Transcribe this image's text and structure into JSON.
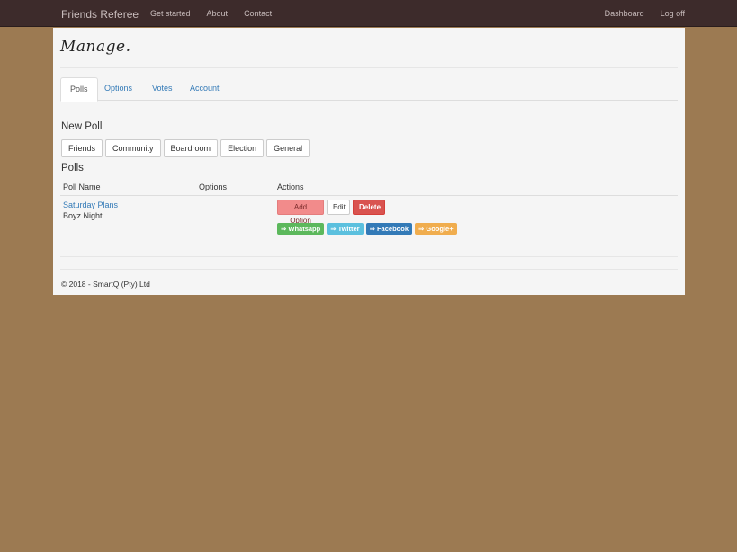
{
  "navbar": {
    "brand": "Friends Referee",
    "left_links": [
      "Get started",
      "About",
      "Contact"
    ],
    "right_links": [
      "Dashboard",
      "Log off"
    ]
  },
  "page": {
    "title": "Manage."
  },
  "tabs": [
    "Polls",
    "Options",
    "Votes",
    "Account"
  ],
  "active_tab": "Polls",
  "new_poll": {
    "heading": "New Poll",
    "types": [
      "Friends",
      "Community",
      "Boardroom",
      "Election",
      "General"
    ]
  },
  "polls": {
    "heading": "Polls",
    "columns": [
      "Poll Name",
      "Options",
      "Actions"
    ],
    "rows": [
      {
        "name": "Saturday Plans",
        "subtitle": "Boyz Night",
        "actions": {
          "add": "Add Option",
          "edit": "Edit",
          "delete": "Delete"
        },
        "shares": [
          "⇒ Whatsapp",
          "⇒ Twitter",
          "⇒ Facebook",
          "⇒ Google+"
        ]
      }
    ]
  },
  "footer": {
    "text": "© 2018 - SmartQ (Pty) Ltd"
  },
  "colors": {
    "background": "#9c7a52",
    "navbar": "#3d2b2b",
    "link": "#337ab7",
    "danger": "#d9534f",
    "add_option": "#f28b8b",
    "whatsapp": "#5cb85c",
    "twitter": "#5bc0de",
    "facebook": "#337ab7",
    "google": "#f0ad4e"
  }
}
